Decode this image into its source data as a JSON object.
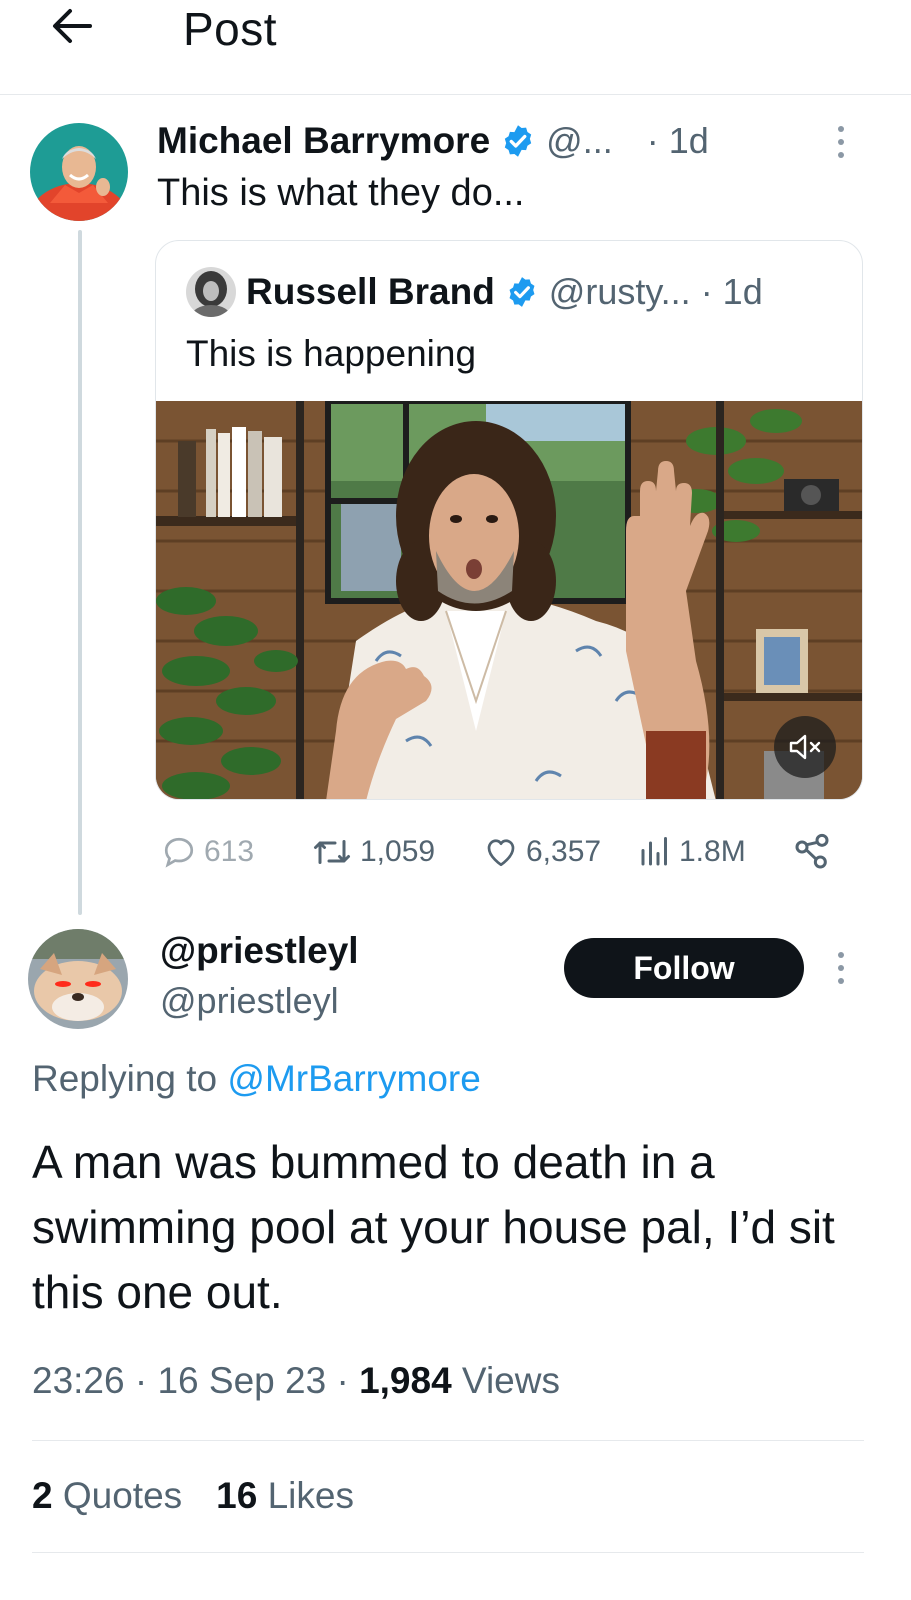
{
  "header": {
    "title": "Post",
    "back_icon": "arrow-left-icon"
  },
  "parent": {
    "name": "Michael Barrymore",
    "handle": "@...",
    "time": "· 1d",
    "text": "This is what they do...",
    "quote": {
      "name": "Russell Brand",
      "handle": "@rusty...",
      "time": "· 1d",
      "text": "This is happening",
      "video_mute_icon": "volume-muted-icon"
    },
    "actions": {
      "replies": "613",
      "reposts": "1,059",
      "likes": "6,357",
      "views": "1.8M"
    }
  },
  "reply": {
    "name": "@priestleyl",
    "handle": "@priestleyl",
    "follow_label": "Follow",
    "replying_prefix": "Replying to ",
    "replying_to": "@MrBarrymore",
    "text": "A man was bummed to death in a swimming pool at your house pal, I’d sit this one out.",
    "time": "23:26 · 16 Sep 23 · ",
    "views_count": "1,984",
    "views_label": " Views",
    "quotes_count": "2",
    "quotes_label": " Quotes",
    "likes_count": "16",
    "likes_label": " Likes"
  },
  "colors": {
    "accent": "#1d9bf0",
    "text": "#0f1419",
    "muted": "#536471",
    "follow_bg": "#0f1419"
  }
}
